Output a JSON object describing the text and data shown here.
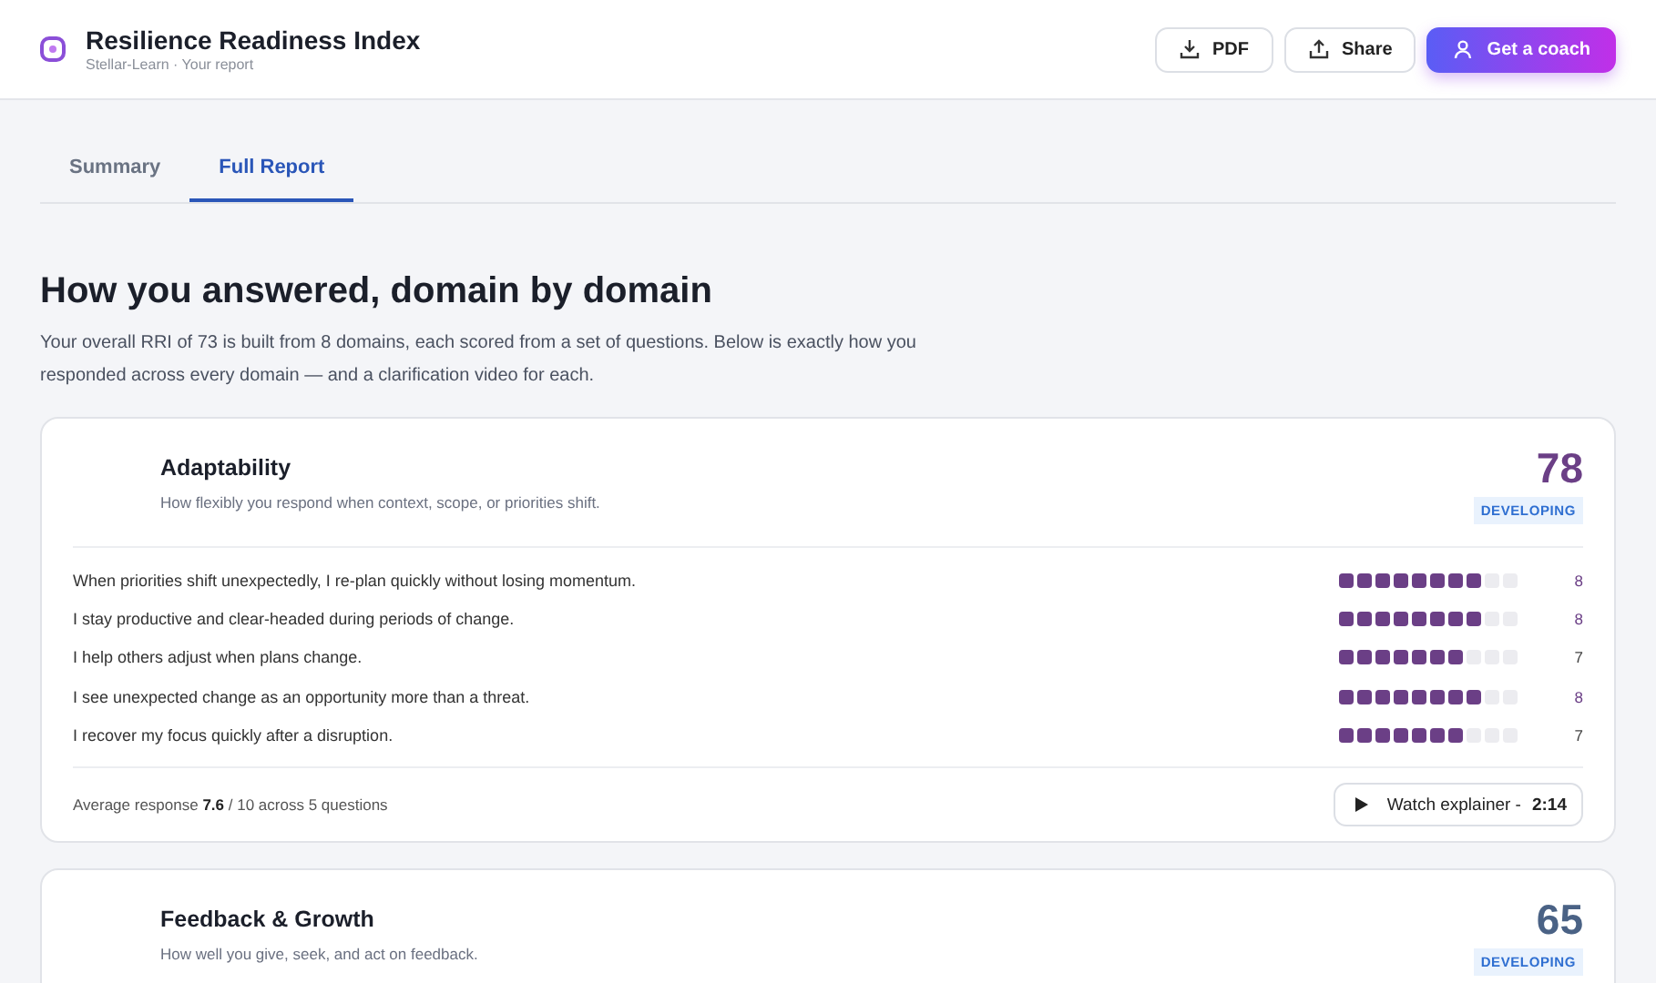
{
  "header": {
    "title": "Resilience Readiness Index",
    "subtitle": "Stellar-Learn · Your report",
    "buttons": [
      {
        "kind": "pdf",
        "label": "PDF"
      },
      {
        "kind": "share",
        "label": "Share"
      },
      {
        "kind": "coach",
        "label": "Get a coach"
      }
    ]
  },
  "tabs": [
    {
      "label": "Summary",
      "selected": false
    },
    {
      "label": "Full Report",
      "selected": true
    }
  ],
  "heading": "How you answered, domain by domain",
  "intro": "Your overall RRI of 73 is built from 8 domains, each scored from a set of questions. Below is exactly how you responded across every domain — and a clarification video for each.",
  "domains": [
    {
      "title": "Adaptability",
      "description": "How flexibly you respond when context, scope, or priorities shift.",
      "score": "78",
      "color": "#6b3f86",
      "badge": "DEVELOPING",
      "questions": [
        {
          "text": "When priorities shift unexpectedly, I re-plan quickly without losing momentum.",
          "stars": 8,
          "value": "8"
        },
        {
          "text": "I stay productive and clear-headed during periods of change.",
          "stars": 8,
          "value": "8"
        },
        {
          "text": "I help others adjust when plans change.",
          "stars": 7,
          "value": "7"
        },
        {
          "text": "I see unexpected change as an opportunity more than a threat.",
          "stars": 8,
          "value": "8"
        },
        {
          "text": "I recover my focus quickly after a disruption.",
          "stars": 7,
          "value": "7"
        }
      ],
      "summary": "Average response **7.6** / 10 across 5 questions",
      "video": {
        "label": "Watch explainer -",
        "duration": "2:14"
      }
    },
    {
      "title": "Feedback & Growth",
      "description": "How well you give, seek, and act on feedback.",
      "score": "65",
      "color": "#4a6285",
      "badge": "DEVELOPING"
    }
  ]
}
